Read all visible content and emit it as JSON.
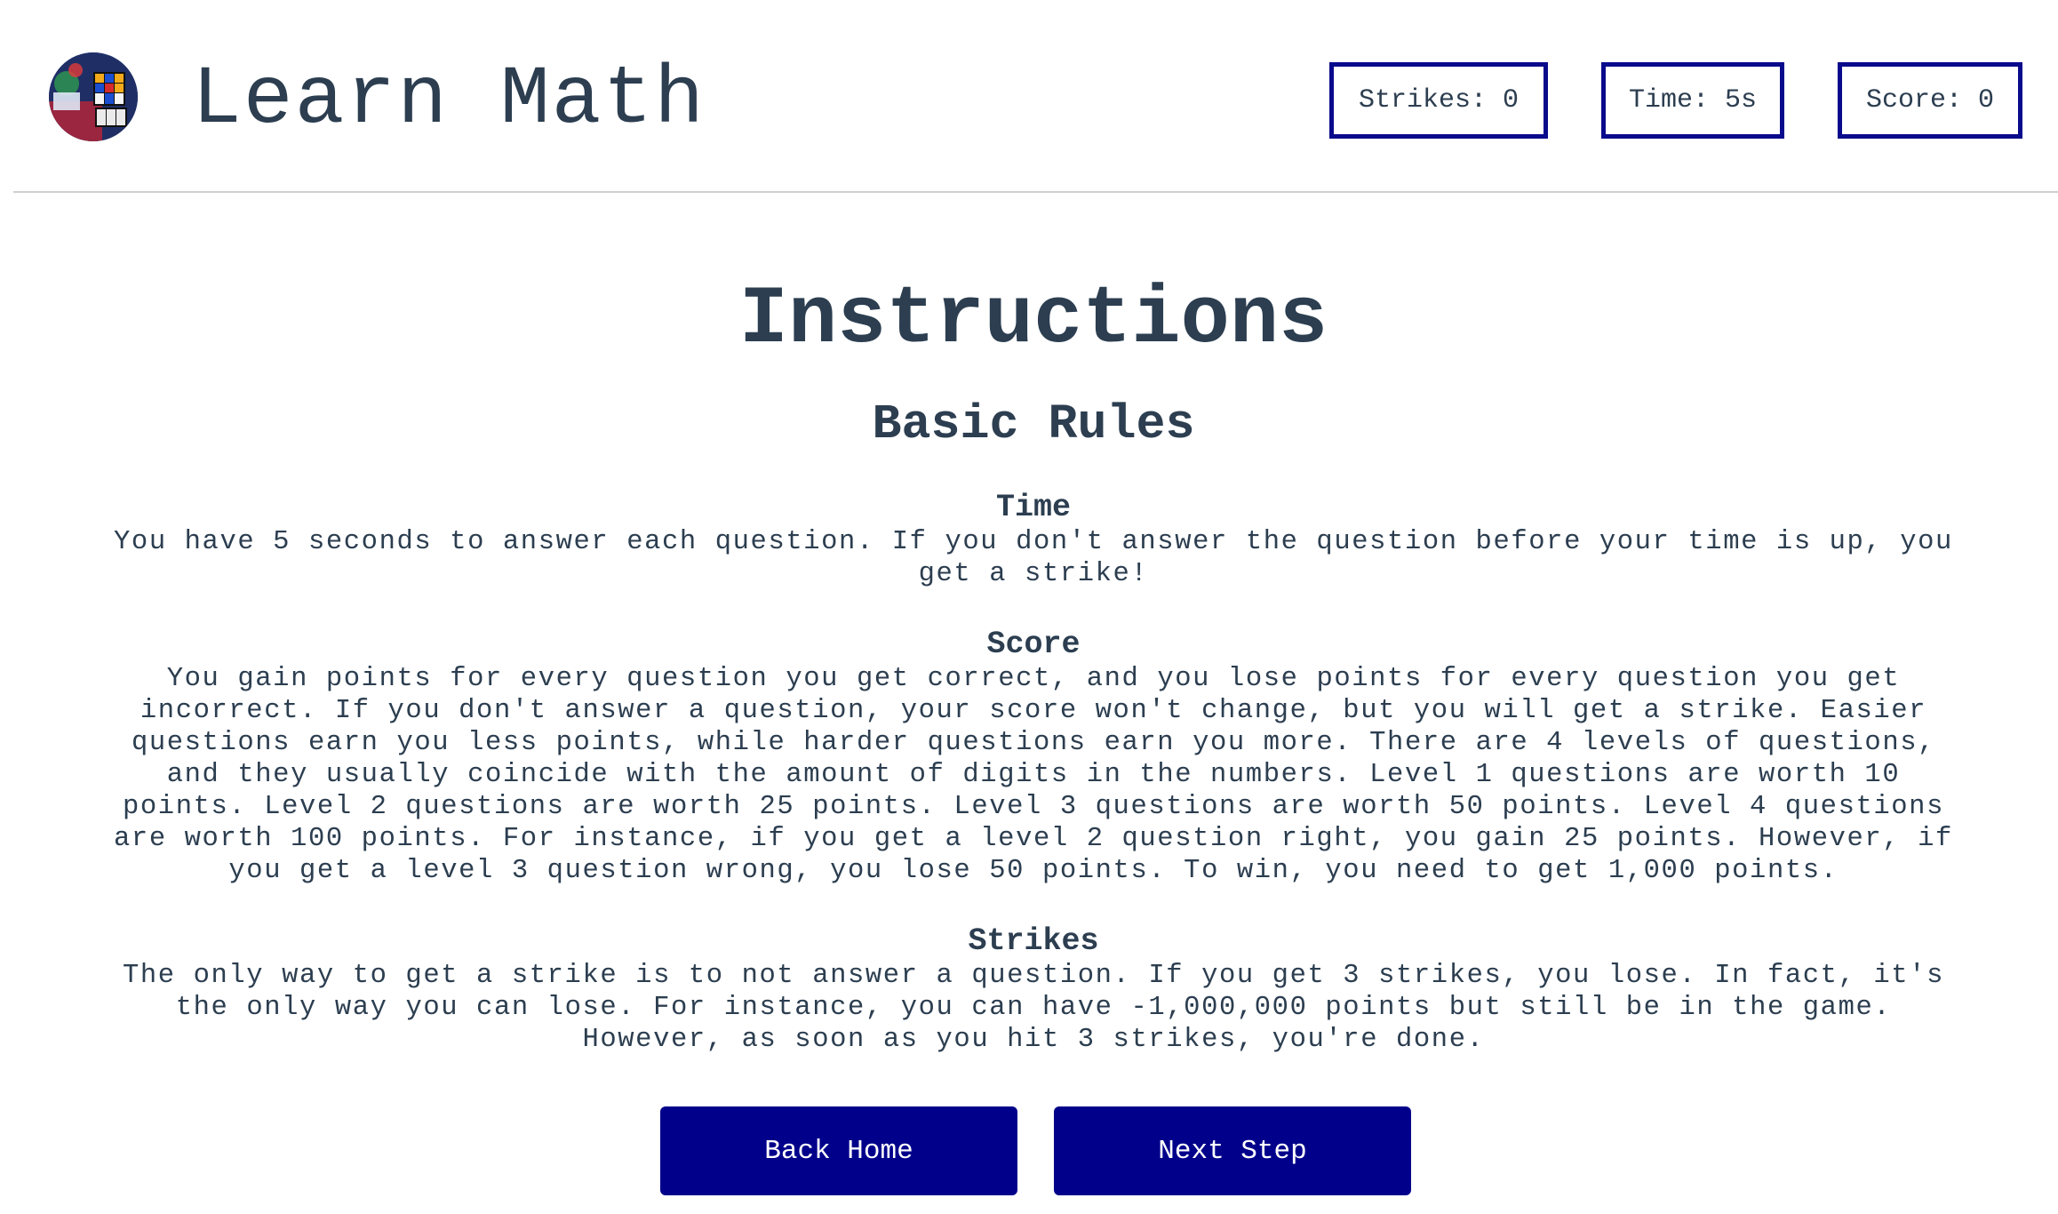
{
  "header": {
    "logo_icon": "rubiks-cube-avatar",
    "title": "Learn Math",
    "stats": {
      "strikes": "Strikes: 0",
      "time": "Time: 5s",
      "score": "Score: 0"
    }
  },
  "main": {
    "title": "Instructions",
    "section_title": "Basic Rules",
    "rules": [
      {
        "heading": "Time",
        "text": "You have 5 seconds to answer each question. If you don't answer the question before your time is up, you get a strike!"
      },
      {
        "heading": "Score",
        "text": "You gain points for every question you get correct, and you lose points for every question you get incorrect. If you don't answer a question, your score won't change, but you will get a strike. Easier questions earn you less points, while harder questions earn you more. There are 4 levels of questions, and they usually coincide with the amount of digits in the numbers. Level 1 questions are worth 10 points. Level 2 questions are worth 25 points. Level 3 questions are worth 50 points. Level 4 questions are worth 100 points. For instance, if you get a level 2 question right, you gain 25 points. However, if you get a level 3 question wrong, you lose 50 points. To win, you need to get 1,000 points."
      },
      {
        "heading": "Strikes",
        "text": "The only way to get a strike is to not answer a question. If you get 3 strikes, you lose. In fact, it's the only way you can lose. For instance, you can have -1,000,000 points but still be in the game. However, as soon as you hit 3 strikes, you're done."
      }
    ]
  },
  "buttons": {
    "back": "Back Home",
    "next": "Next Step"
  },
  "colors": {
    "accent": "#00008b",
    "text": "#2c3e50",
    "stat_border": "#0a0a8c"
  }
}
